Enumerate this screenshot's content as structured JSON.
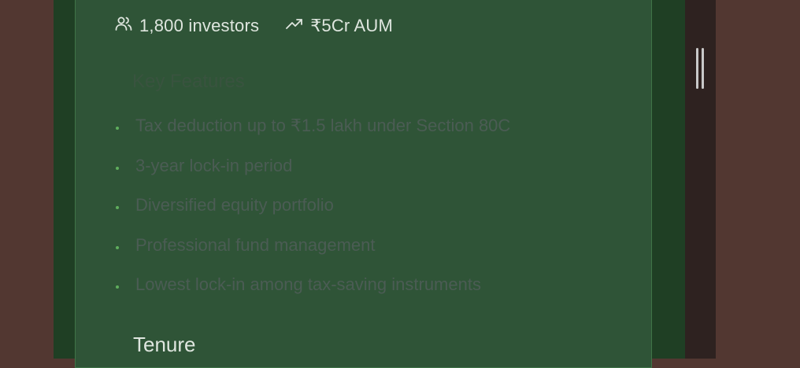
{
  "stats": {
    "investors_icon": "users-icon",
    "investors": "1,800 investors",
    "aum_icon": "trending-up-icon",
    "aum": "₹5Cr AUM"
  },
  "key_features": {
    "title": "Key Features",
    "items": [
      "Tax deduction up to ₹1.5 lakh under Section 80C",
      "3-year lock-in period",
      "Diversified equity portfolio",
      "Professional fund management",
      "Lowest lock-in among tax-saving instruments"
    ]
  },
  "tenure": {
    "label": "Tenure"
  },
  "colors": {
    "background": "#523731",
    "card": "#2f5437",
    "bullet": "#5fae5d",
    "feature_text": "#4b5c54"
  }
}
